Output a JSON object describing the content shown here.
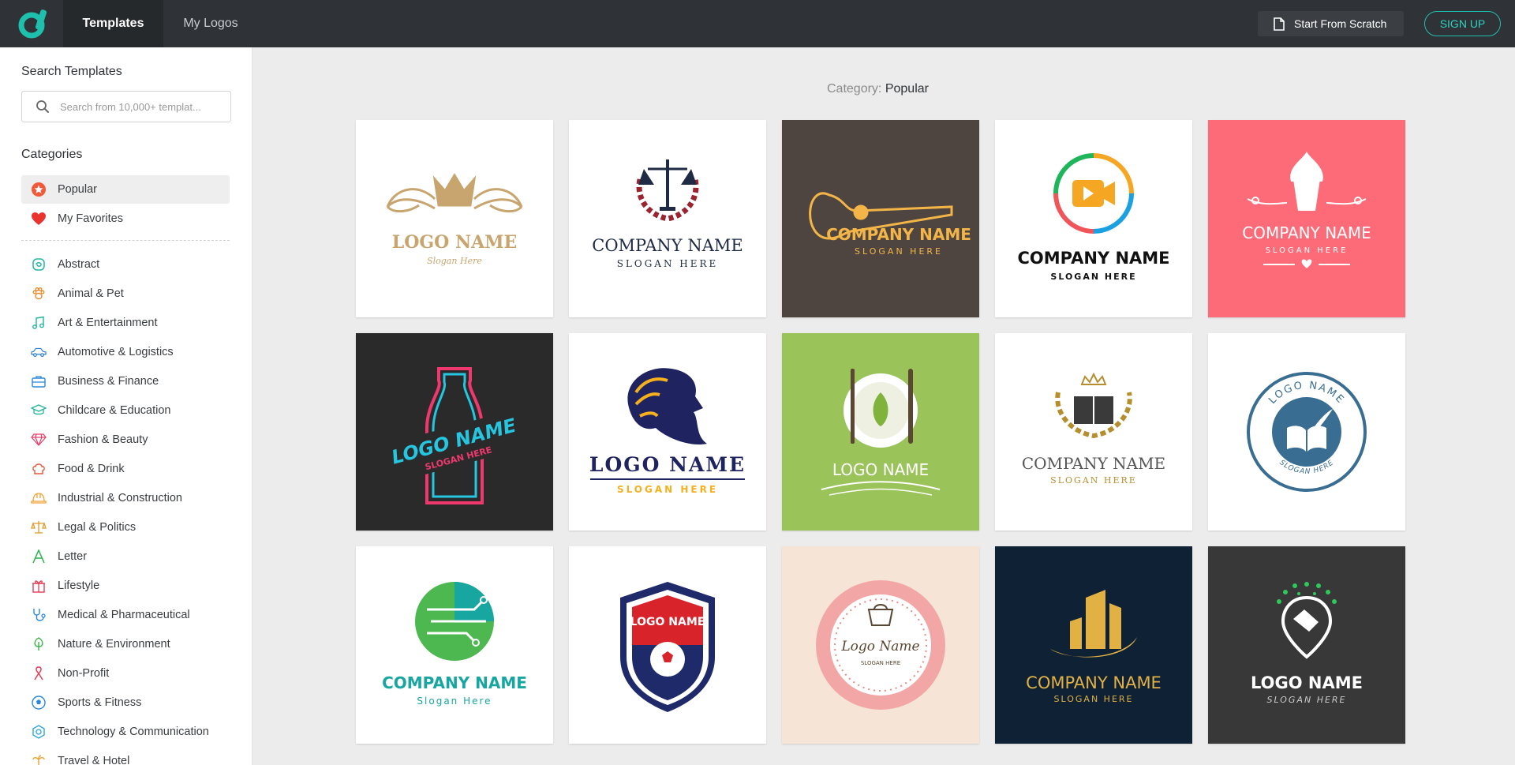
{
  "header": {
    "tabs": [
      {
        "label": "Templates",
        "active": true
      },
      {
        "label": "My Logos",
        "active": false
      }
    ],
    "start_from_scratch_label": "Start From Scratch",
    "signup_label": "SIGN UP",
    "accent_color": "#1fbfae"
  },
  "sidebar": {
    "search_heading": "Search Templates",
    "search_placeholder": "Search from 10,000+ templat...",
    "categories_heading": "Categories",
    "pinned": [
      {
        "label": "Popular",
        "icon": "star-badge-icon",
        "selected": true
      },
      {
        "label": "My Favorites",
        "icon": "heart-icon",
        "selected": false
      }
    ],
    "items": [
      {
        "label": "Abstract",
        "icon": "abstract-swirl-icon"
      },
      {
        "label": "Animal & Pet",
        "icon": "paw-icon"
      },
      {
        "label": "Art & Entertainment",
        "icon": "music-note-icon"
      },
      {
        "label": "Automotive & Logistics",
        "icon": "car-icon"
      },
      {
        "label": "Business & Finance",
        "icon": "briefcase-icon"
      },
      {
        "label": "Childcare & Education",
        "icon": "graduation-cap-icon"
      },
      {
        "label": "Fashion & Beauty",
        "icon": "diamond-icon"
      },
      {
        "label": "Food & Drink",
        "icon": "chef-hat-icon"
      },
      {
        "label": "Industrial & Construction",
        "icon": "hard-hat-icon"
      },
      {
        "label": "Legal & Politics",
        "icon": "scales-icon"
      },
      {
        "label": "Letter",
        "icon": "letter-a-icon"
      },
      {
        "label": "Lifestyle",
        "icon": "gift-icon"
      },
      {
        "label": "Medical & Pharmaceutical",
        "icon": "stethoscope-icon"
      },
      {
        "label": "Nature & Environment",
        "icon": "tree-icon"
      },
      {
        "label": "Non-Profit",
        "icon": "ribbon-icon"
      },
      {
        "label": "Sports & Fitness",
        "icon": "soccer-ball-icon"
      },
      {
        "label": "Technology & Communication",
        "icon": "chip-icon"
      },
      {
        "label": "Travel & Hotel",
        "icon": "palm-tree-icon"
      }
    ]
  },
  "main": {
    "category_prefix": "Category:",
    "category_value": "Popular",
    "templates": [
      {
        "name": "LOGO NAME",
        "slogan": "Slogan Here",
        "icon": "crown-ornament-icon",
        "bg": "#ffffff"
      },
      {
        "name": "COMPANY NAME",
        "slogan": "SLOGAN HERE",
        "icon": "justice-scales-icon",
        "bg": "#ffffff"
      },
      {
        "name": "COMPANY NAME",
        "slogan": "SLOGAN HERE",
        "icon": "guitar-icon",
        "bg": "#4e4540"
      },
      {
        "name": "COMPANY NAME",
        "slogan": "SLOGAN HERE",
        "icon": "video-camera-icon",
        "bg": "#ffffff"
      },
      {
        "name": "COMPANY NAME",
        "slogan": "SLOGAN HERE",
        "icon": "cupcake-icon",
        "bg": "#fd6b78"
      },
      {
        "name": "LOGO NAME",
        "slogan": "SLOGAN HERE",
        "icon": "neon-bottle-icon",
        "bg": "#2a2a2a"
      },
      {
        "name": "LOGO NAME",
        "slogan": "SLOGAN HERE",
        "icon": "lion-head-icon",
        "bg": "#ffffff"
      },
      {
        "name": "LOGO NAME",
        "slogan": "",
        "icon": "plate-cutlery-icon",
        "bg": "#9ac35a"
      },
      {
        "name": "COMPANY NAME",
        "slogan": "SLOGAN HERE",
        "icon": "book-laurel-icon",
        "bg": "#ffffff"
      },
      {
        "name": "LOGO NAME",
        "slogan": "SLOGAN HERE",
        "icon": "book-quill-badge-icon",
        "bg": "#ffffff"
      },
      {
        "name": "COMPANY NAME",
        "slogan": "Slogan Here",
        "icon": "circuit-circle-icon",
        "bg": "#ffffff"
      },
      {
        "name": "LOGO NAME",
        "slogan": "",
        "icon": "soccer-shield-icon",
        "bg": "#ffffff"
      },
      {
        "name": "Logo Name",
        "slogan": "SLOGAN HERE",
        "icon": "cake-scallop-icon",
        "bg": "#f6e4d6"
      },
      {
        "name": "COMPANY NAME",
        "slogan": "SLOGAN HERE",
        "icon": "gold-building-icon",
        "bg": "#0e2135"
      },
      {
        "name": "LOGO NAME",
        "slogan": "SLOGAN HERE",
        "icon": "handshake-pin-icon",
        "bg": "#383838"
      }
    ]
  }
}
